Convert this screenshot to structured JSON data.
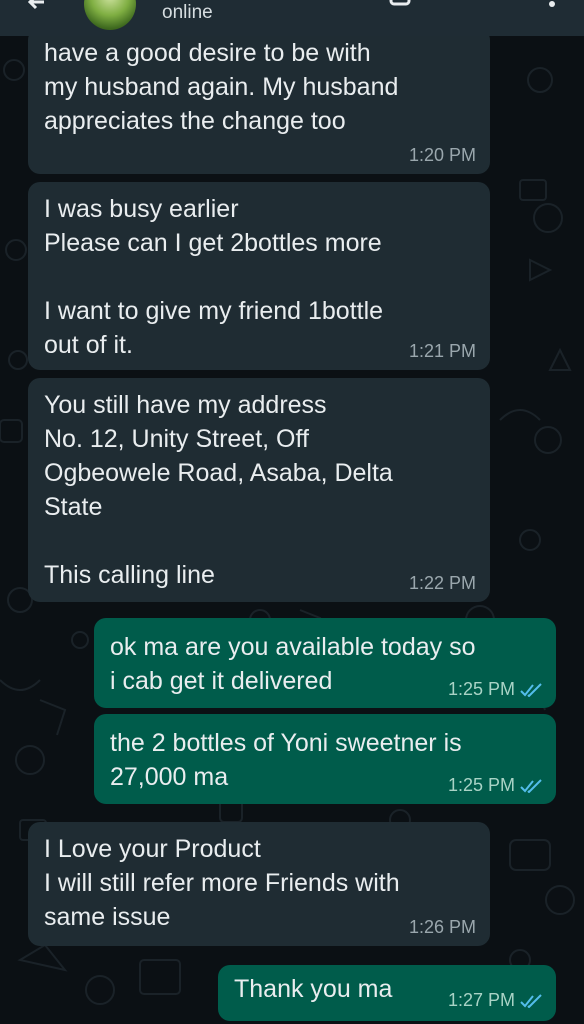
{
  "header": {
    "status": "online"
  },
  "messages": [
    {
      "direction": "in",
      "text": "have a good desire to be with\nmy husband again. My husband\nappreciates the change too",
      "time": "1:20 PM"
    },
    {
      "direction": "in",
      "text": "I was busy earlier\nPlease can I get 2bottles more\n\nI want to give my friend 1bottle\nout of it.",
      "time": "1:21 PM"
    },
    {
      "direction": "in",
      "text": "You still have my address\nNo. 12, Unity Street, Off\nOgbeowele Road, Asaba, Delta\nState\n\nThis calling line",
      "time": "1:22 PM"
    },
    {
      "direction": "out",
      "text": "ok ma are you available today so\ni cab get it delivered",
      "time": "1:25 PM",
      "status": "read"
    },
    {
      "direction": "out",
      "text": "the 2 bottles of Yoni sweetner is\n27,000 ma",
      "time": "1:25 PM",
      "status": "read"
    },
    {
      "direction": "in",
      "text": "I Love your Product\nI will still refer more Friends with\nsame issue",
      "time": "1:26 PM"
    },
    {
      "direction": "out",
      "text": "Thank you ma",
      "time": "1:27 PM",
      "status": "read"
    }
  ],
  "colors": {
    "background": "#0b1014",
    "incoming_bubble": "#1f2c33",
    "outgoing_bubble": "#005c4b",
    "read_tick": "#53bdeb"
  }
}
